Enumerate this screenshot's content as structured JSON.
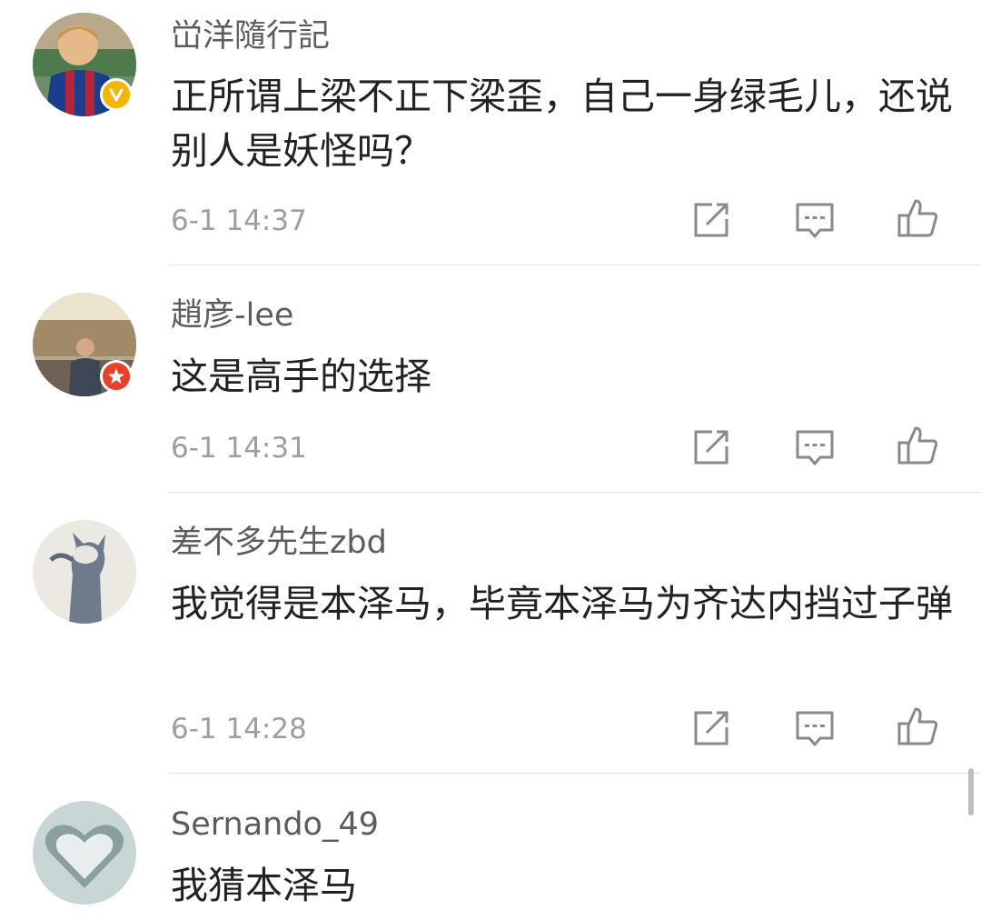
{
  "comments": [
    {
      "username": "峃洋隨行記",
      "text": "正所谓上梁不正下梁歪，自己一身绿毛儿，还说别人是妖怪吗？",
      "timestamp": "6-1 14:37",
      "badge": "verified-gold",
      "badge_color": "#f3b500"
    },
    {
      "username": "趙彦-lee",
      "text": "这是高手的选择",
      "timestamp": "6-1 14:31",
      "badge": "star-red",
      "badge_color": "#e8402a"
    },
    {
      "username": "差不多先生zbd",
      "text": "我觉得是本泽马，毕竟本泽马为齐达内挡过子弹",
      "timestamp": "6-1 14:28"
    },
    {
      "username": "Sernando_49",
      "text": "我猜本泽马"
    }
  ],
  "icons": {
    "repost": "repost-icon",
    "comment": "comment-icon",
    "like": "like-icon"
  }
}
